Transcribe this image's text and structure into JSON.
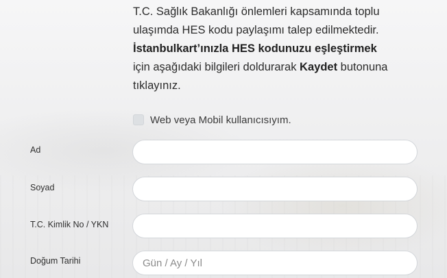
{
  "intro": {
    "line1": "T.C. Sağlık Bakanlığı önlemleri kapsamında toplu",
    "line2": "ulaşımda HES kodu paylaşımı talep edilmektedir.",
    "line3_bold": "İstanbulkart’ınızla HES kodunuzu eşleştirmek",
    "line4_prefix": "için aşağıdaki bilgileri doldurarak ",
    "line4_bold": "Kaydet",
    "line4_suffix": " butonuna",
    "line5": "tıklayınız."
  },
  "web_mobile_checkbox": {
    "label": "Web veya Mobil kullanıcısıyım.",
    "checked": false
  },
  "form": {
    "ad": {
      "label": "Ad",
      "value": "",
      "placeholder": ""
    },
    "soyad": {
      "label": "Soyad",
      "value": "",
      "placeholder": ""
    },
    "kimlik": {
      "label": "T.C. Kimlik No / YKN",
      "value": "",
      "placeholder": ""
    },
    "dogum_tarihi": {
      "label": "Doğum Tarihi",
      "value": "",
      "placeholder": "Gün / Ay / Yıl"
    }
  }
}
